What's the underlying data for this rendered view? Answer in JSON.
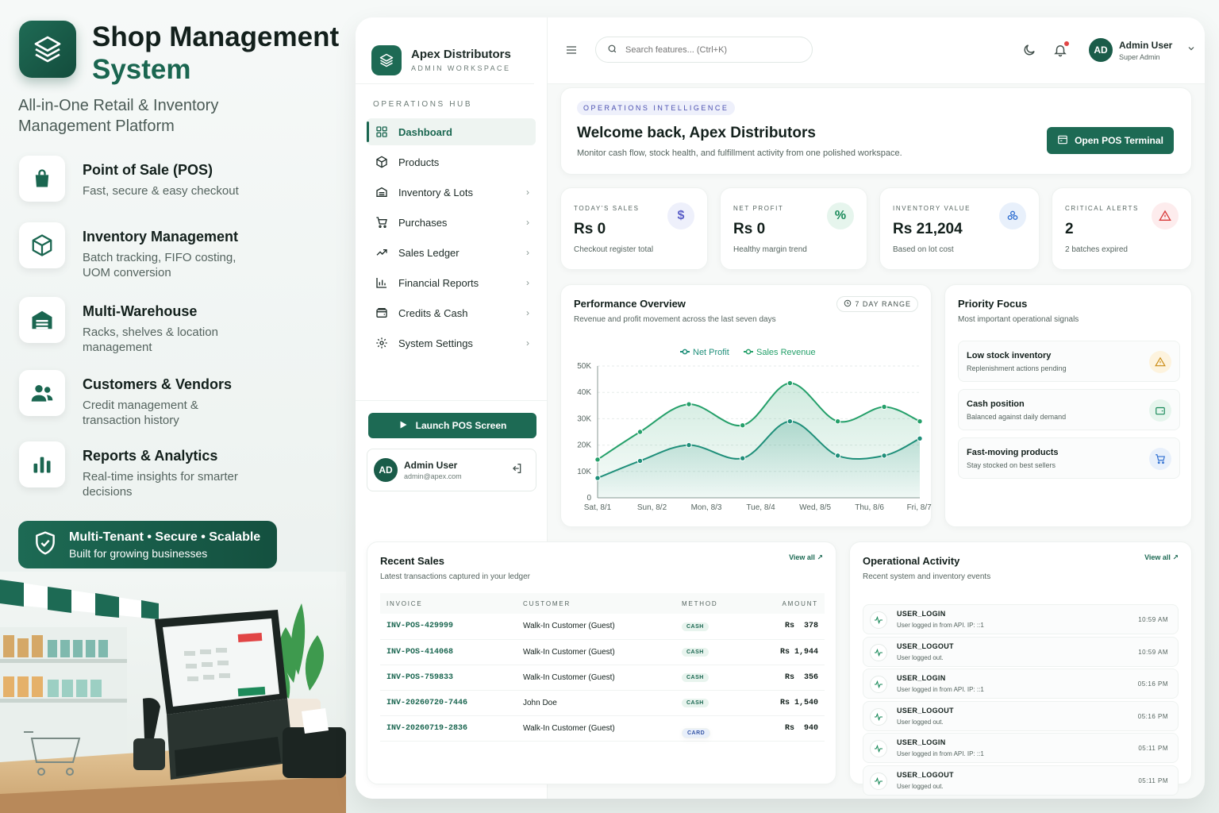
{
  "brand": {
    "title_line1": "Shop Management",
    "title_line2": "System",
    "tagline": "All-in-One Retail & Inventory Management Platform"
  },
  "features": [
    {
      "title": "Point of Sale (POS)",
      "desc": "Fast, secure & easy checkout",
      "icon": "shopping-bag-icon"
    },
    {
      "title": "Inventory Management",
      "desc": "Batch tracking, FIFO costing, UOM conversion",
      "icon": "box-icon"
    },
    {
      "title": "Multi-Warehouse",
      "desc": "Racks, shelves & location management",
      "icon": "warehouse-icon"
    },
    {
      "title": "Customers & Vendors",
      "desc": "Credit management & transaction history",
      "icon": "users-icon"
    },
    {
      "title": "Reports & Analytics",
      "desc": "Real-time insights for smarter decisions",
      "icon": "bar-chart-icon"
    }
  ],
  "banner": {
    "line1": "Multi-Tenant • Secure • Scalable",
    "line2": "Built for growing businesses"
  },
  "sidebar": {
    "company": "Apex Distributors",
    "workspace": "ADMIN WORKSPACE",
    "section": "OPERATIONS HUB",
    "items": [
      {
        "label": "Dashboard",
        "icon": "grid-icon",
        "active": true
      },
      {
        "label": "Products",
        "icon": "cube-icon"
      },
      {
        "label": "Inventory & Lots",
        "icon": "warehouse-icon"
      },
      {
        "label": "Purchases",
        "icon": "cart-icon"
      },
      {
        "label": "Sales Ledger",
        "icon": "trend-icon"
      },
      {
        "label": "Financial Reports",
        "icon": "bar-chart-icon"
      },
      {
        "label": "Credits & Cash",
        "icon": "wallet-icon"
      },
      {
        "label": "System Settings",
        "icon": "gear-icon"
      }
    ],
    "launch_label": "Launch POS Screen",
    "user": {
      "initials": "AD",
      "name": "Admin User",
      "email": "admin@apex.com"
    }
  },
  "topbar": {
    "search_placeholder": "Search features... (Ctrl+K)",
    "user": {
      "initials": "AD",
      "name": "Admin User",
      "role": "Super Admin"
    }
  },
  "welcome": {
    "pill": "OPERATIONS INTELLIGENCE",
    "title": "Welcome back, Apex Distributors",
    "subtitle": "Monitor cash flow, stock health, and fulfillment activity from one polished workspace.",
    "button": "Open POS Terminal"
  },
  "stats": [
    {
      "label": "TODAY'S SALES",
      "value": "Rs 0",
      "sub": "Checkout register total",
      "icon": "dollar-icon",
      "color": "#5b5fc7",
      "bg": "#eef0fb"
    },
    {
      "label": "NET PROFIT",
      "value": "Rs 0",
      "sub": "Healthy margin trend",
      "icon": "percent-icon",
      "color": "#1a8a5a",
      "bg": "#e6f5ed"
    },
    {
      "label": "INVENTORY VALUE",
      "value": "Rs 21,204",
      "sub": "Based on lot cost",
      "icon": "boxes-icon",
      "color": "#2f6fd1",
      "bg": "#e8f0fb"
    },
    {
      "label": "CRITICAL ALERTS",
      "value": "2",
      "sub": "2 batches expired",
      "icon": "alert-icon",
      "color": "#d83a3a",
      "bg": "#fdeced"
    }
  ],
  "performance": {
    "title": "Performance Overview",
    "subtitle": "Revenue and profit movement across the last seven days",
    "range": "7 DAY RANGE"
  },
  "chart_data": {
    "type": "area",
    "categories": [
      "Sat, 8/1",
      "Sun, 8/2",
      "Mon, 8/3",
      "Tue, 8/4",
      "Wed, 8/5",
      "Thu, 8/6",
      "Fri, 8/7"
    ],
    "series": [
      {
        "name": "Net Profit",
        "values": [
          7500,
          14000,
          20000,
          15000,
          29000,
          16000,
          16000,
          22500
        ],
        "x": [
          0,
          0.87,
          1.87,
          2.97,
          3.94,
          4.92,
          5.87,
          6.6
        ]
      },
      {
        "name": "Sales Revenue",
        "values": [
          14500,
          25000,
          35500,
          27500,
          43500,
          29000,
          34500,
          29000
        ],
        "x": [
          0,
          0.87,
          1.87,
          2.97,
          3.94,
          4.92,
          5.87,
          6.6
        ]
      }
    ],
    "colors": {
      "Net Profit": "#1f8f7a",
      "Sales Revenue": "#25a06a"
    },
    "yticks": [
      0,
      10000,
      20000,
      30000,
      40000,
      50000
    ],
    "ytick_labels": [
      "0",
      "10K",
      "20K",
      "30K",
      "40K",
      "50K"
    ],
    "ylim": [
      0,
      50000
    ],
    "legend": "top-center",
    "grid": "horizontal-dashed"
  },
  "priority": {
    "title": "Priority Focus",
    "subtitle": "Most important operational signals",
    "items": [
      {
        "title": "Low stock inventory",
        "desc": "Replenishment actions pending",
        "icon": "warning-icon",
        "color": "#c98a12",
        "bg": "#fdf3de"
      },
      {
        "title": "Cash position",
        "desc": "Balanced against daily demand",
        "icon": "wallet-icon",
        "color": "#1a8a5a",
        "bg": "#e6f5ed"
      },
      {
        "title": "Fast-moving products",
        "desc": "Stay stocked on best sellers",
        "icon": "cart-icon",
        "color": "#2f6fd1",
        "bg": "#e8f0fb"
      }
    ]
  },
  "recent": {
    "title": "Recent Sales",
    "subtitle": "Latest transactions captured in your ledger",
    "view_all": "View all",
    "columns": [
      "INVOICE",
      "CUSTOMER",
      "METHOD",
      "AMOUNT"
    ],
    "rows": [
      {
        "invoice": "INV-POS-429999",
        "customer": "Walk-In Customer (Guest)",
        "method": "CASH",
        "amount": "Rs  378"
      },
      {
        "invoice": "INV-POS-414068",
        "customer": "Walk-In Customer (Guest)",
        "method": "CASH",
        "amount": "Rs 1,944"
      },
      {
        "invoice": "INV-POS-759833",
        "customer": "Walk-In Customer (Guest)",
        "method": "CASH",
        "amount": "Rs  356"
      },
      {
        "invoice": "INV-20260720-7446",
        "customer": "John Doe",
        "method": "CASH",
        "amount": "Rs 1,540"
      },
      {
        "invoice": "INV-20260719-2836",
        "customer": "Walk-In Customer (Guest)",
        "method": "CARD",
        "amount": "Rs  940"
      }
    ]
  },
  "operational": {
    "title": "Operational Activity",
    "subtitle": "Recent system and inventory events",
    "view_all": "View all",
    "items": [
      {
        "event": "USER_LOGIN",
        "desc": "User logged in from API. IP: ::1",
        "time": "10:59 AM"
      },
      {
        "event": "USER_LOGOUT",
        "desc": "User logged out.",
        "time": "10:59 AM"
      },
      {
        "event": "USER_LOGIN",
        "desc": "User logged in from API. IP: ::1",
        "time": "05:16 PM"
      },
      {
        "event": "USER_LOGOUT",
        "desc": "User logged out.",
        "time": "05:16 PM"
      },
      {
        "event": "USER_LOGIN",
        "desc": "User logged in from API. IP: ::1",
        "time": "05:11 PM"
      },
      {
        "event": "USER_LOGOUT",
        "desc": "User logged out.",
        "time": "05:11 PM"
      }
    ]
  }
}
